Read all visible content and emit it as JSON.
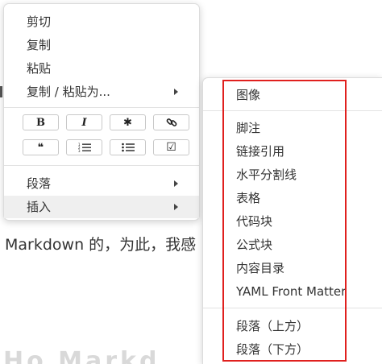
{
  "background": {
    "paragraph_text": "Markdown 的，为此，我感",
    "heading_fragment": "Ho Markd"
  },
  "context_menu": {
    "items": [
      {
        "label": "剪切"
      },
      {
        "label": "复制"
      },
      {
        "label": "粘贴"
      },
      {
        "label": "复制 / 粘贴为..."
      }
    ],
    "format_buttons": [
      {
        "name": "bold",
        "glyph": "B"
      },
      {
        "name": "italic",
        "glyph": "I"
      },
      {
        "name": "code",
        "glyph": "✱"
      },
      {
        "name": "link",
        "glyph": ""
      },
      {
        "name": "quote",
        "glyph": "❝"
      },
      {
        "name": "ordered-list",
        "glyph": ""
      },
      {
        "name": "unordered-list",
        "glyph": ""
      },
      {
        "name": "task-list",
        "glyph": "☑"
      }
    ],
    "paragraph_label": "段落",
    "insert_label": "插入"
  },
  "insert_submenu": {
    "items": [
      "图像",
      "脚注",
      "链接引用",
      "水平分割线",
      "表格",
      "代码块",
      "公式块",
      "内容目录",
      "YAML Front Matter",
      "段落（上方）",
      "段落（下方）"
    ],
    "highlight_color": "#e0201e"
  }
}
